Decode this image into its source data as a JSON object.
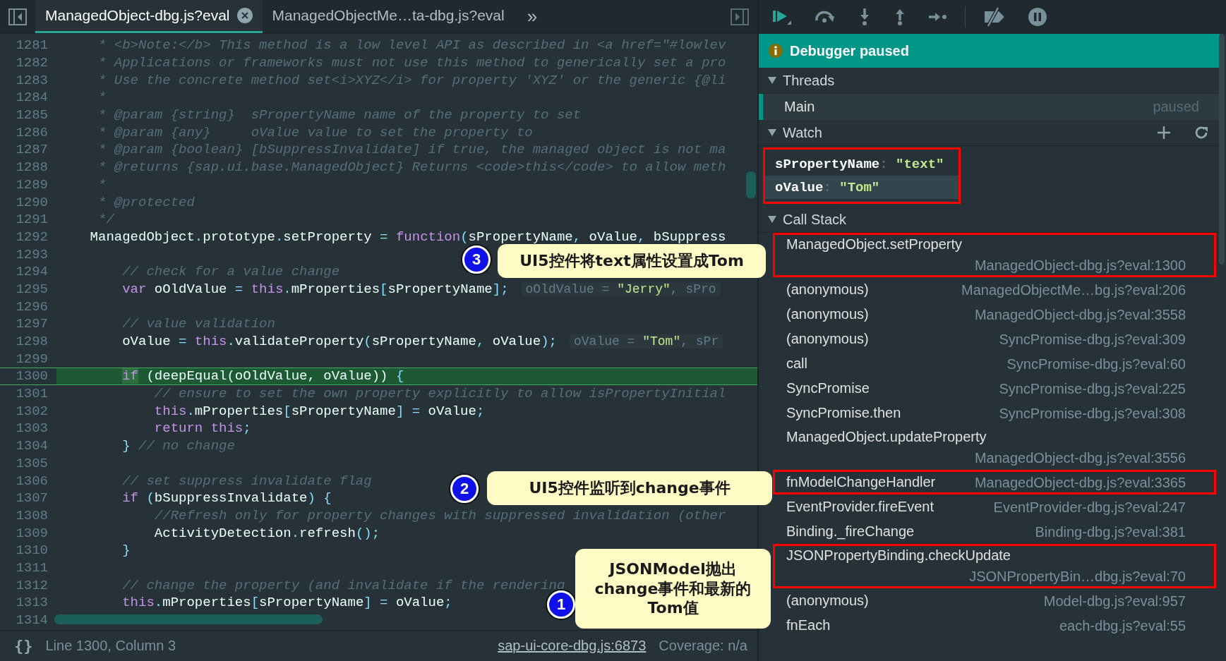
{
  "tabs": [
    {
      "label": "ManagedObject-dbg.js?eval",
      "selected": true,
      "closable": true
    },
    {
      "label": "ManagedObjectMe…ta-dbg.js?eval",
      "selected": false,
      "closable": false
    }
  ],
  "more_tabs": "»",
  "code": {
    "lines": [
      {
        "number": "1281",
        "current": false,
        "tokens": [
          {
            "kind": "comment",
            "text": "     * <b>Note:</b> This method is a low level API as described in <a href=\"#lowlev"
          }
        ]
      },
      {
        "number": "1282",
        "current": false,
        "tokens": [
          {
            "kind": "comment",
            "text": "     * Applications or frameworks must not use this method to generically set a pro"
          }
        ]
      },
      {
        "number": "1283",
        "current": false,
        "tokens": [
          {
            "kind": "comment",
            "text": "     * Use the concrete method set<i>XYZ</i> for property 'XYZ' or the generic {@li"
          }
        ]
      },
      {
        "number": "1284",
        "current": false,
        "tokens": [
          {
            "kind": "comment",
            "text": "     *"
          }
        ]
      },
      {
        "number": "1285",
        "current": false,
        "tokens": [
          {
            "kind": "comment",
            "text": "     * @param {string}  sPropertyName name of the property to set"
          }
        ]
      },
      {
        "number": "1286",
        "current": false,
        "tokens": [
          {
            "kind": "comment",
            "text": "     * @param {any}     oValue value to set the property to"
          }
        ]
      },
      {
        "number": "1287",
        "current": false,
        "tokens": [
          {
            "kind": "comment",
            "text": "     * @param {boolean} [bSuppressInvalidate] if true, the managed object is not ma"
          }
        ]
      },
      {
        "number": "1288",
        "current": false,
        "tokens": [
          {
            "kind": "comment",
            "text": "     * @returns {sap.ui.base.ManagedObject} Returns <code>this</code> to allow meth"
          }
        ]
      },
      {
        "number": "1289",
        "current": false,
        "tokens": [
          {
            "kind": "comment",
            "text": "     *"
          }
        ]
      },
      {
        "number": "1290",
        "current": false,
        "tokens": [
          {
            "kind": "comment",
            "text": "     * @protected"
          }
        ]
      },
      {
        "number": "1291",
        "current": false,
        "tokens": [
          {
            "kind": "comment",
            "text": "     */"
          }
        ]
      },
      {
        "number": "1292",
        "current": false,
        "tokens": [
          {
            "kind": "plain",
            "text": "    ManagedObject"
          },
          {
            "kind": "punct",
            "text": "."
          },
          {
            "kind": "plain",
            "text": "prototype"
          },
          {
            "kind": "punct",
            "text": "."
          },
          {
            "kind": "plain",
            "text": "setProperty "
          },
          {
            "kind": "punct",
            "text": "= "
          },
          {
            "kind": "keyword",
            "text": "function"
          },
          {
            "kind": "punct",
            "text": "("
          },
          {
            "kind": "plain",
            "text": "sPropertyName"
          },
          {
            "kind": "punct",
            "text": ", "
          },
          {
            "kind": "plain",
            "text": "oValue"
          },
          {
            "kind": "punct",
            "text": ", "
          },
          {
            "kind": "plain",
            "text": "bSuppress"
          }
        ]
      },
      {
        "number": "1293",
        "current": false
      },
      {
        "number": "1294",
        "current": false,
        "tokens": [
          {
            "kind": "comment",
            "text": "        // check for a value change"
          }
        ]
      },
      {
        "number": "1295",
        "current": false,
        "tokens": [
          {
            "kind": "keyword",
            "text": "        var "
          },
          {
            "kind": "plain",
            "text": "oOldValue "
          },
          {
            "kind": "punct",
            "text": "= "
          },
          {
            "kind": "keyword",
            "text": "this"
          },
          {
            "kind": "punct",
            "text": "."
          },
          {
            "kind": "plain",
            "text": "mProperties"
          },
          {
            "kind": "punct",
            "text": "["
          },
          {
            "kind": "plain",
            "text": "sPropertyName"
          },
          {
            "kind": "punct",
            "text": "];"
          }
        ],
        "inline_value": [
          {
            "kind": "plain",
            "text": "oOldValue = "
          },
          {
            "kind": "string",
            "text": "\"Jerry\""
          },
          {
            "kind": "plain",
            "text": ", sPro"
          }
        ]
      },
      {
        "number": "1296",
        "current": false
      },
      {
        "number": "1297",
        "current": false,
        "tokens": [
          {
            "kind": "comment",
            "text": "        // value validation"
          }
        ]
      },
      {
        "number": "1298",
        "current": false,
        "tokens": [
          {
            "kind": "plain",
            "text": "        oValue "
          },
          {
            "kind": "punct",
            "text": "= "
          },
          {
            "kind": "keyword",
            "text": "this"
          },
          {
            "kind": "punct",
            "text": "."
          },
          {
            "kind": "plain",
            "text": "validateProperty"
          },
          {
            "kind": "punct",
            "text": "("
          },
          {
            "kind": "plain",
            "text": "sPropertyName"
          },
          {
            "kind": "punct",
            "text": ", "
          },
          {
            "kind": "plain",
            "text": "oValue"
          },
          {
            "kind": "punct",
            "text": ");"
          }
        ],
        "inline_value": [
          {
            "kind": "plain",
            "text": "oValue = "
          },
          {
            "kind": "string",
            "text": "\"Tom\""
          },
          {
            "kind": "plain",
            "text": ", sPr"
          }
        ]
      },
      {
        "number": "1299",
        "current": false
      },
      {
        "number": "1300",
        "current": true,
        "tokens": [
          {
            "kind": "keyword",
            "text": "        if"
          },
          {
            "kind": "plain",
            "text": " (deepEqual(oOldValue, oValue)) "
          },
          {
            "kind": "punct",
            "text": "{"
          }
        ]
      },
      {
        "number": "1301",
        "current": false,
        "tokens": [
          {
            "kind": "comment",
            "text": "            // ensure to set the own property explicitly to allow isPropertyInitial"
          }
        ]
      },
      {
        "number": "1302",
        "current": false,
        "tokens": [
          {
            "kind": "keyword",
            "text": "            this"
          },
          {
            "kind": "punct",
            "text": "."
          },
          {
            "kind": "plain",
            "text": "mProperties"
          },
          {
            "kind": "punct",
            "text": "["
          },
          {
            "kind": "plain",
            "text": "sPropertyName"
          },
          {
            "kind": "punct",
            "text": "] = "
          },
          {
            "kind": "plain",
            "text": "oValue"
          },
          {
            "kind": "punct",
            "text": ";"
          }
        ]
      },
      {
        "number": "1303",
        "current": false,
        "tokens": [
          {
            "kind": "keyword",
            "text": "            return this"
          },
          {
            "kind": "punct",
            "text": ";"
          }
        ]
      },
      {
        "number": "1304",
        "current": false,
        "tokens": [
          {
            "kind": "punct",
            "text": "        }"
          },
          {
            "kind": "comment",
            "text": " // no change"
          }
        ]
      },
      {
        "number": "1305",
        "current": false
      },
      {
        "number": "1306",
        "current": false,
        "tokens": [
          {
            "kind": "comment",
            "text": "        // set suppress invalidate flag"
          }
        ]
      },
      {
        "number": "1307",
        "current": false,
        "tokens": [
          {
            "kind": "keyword",
            "text": "        if "
          },
          {
            "kind": "punct",
            "text": "("
          },
          {
            "kind": "plain",
            "text": "bSuppressInvalidate"
          },
          {
            "kind": "punct",
            "text": ") {"
          }
        ]
      },
      {
        "number": "1308",
        "current": false,
        "tokens": [
          {
            "kind": "comment",
            "text": "            //Refresh only for property changes with suppressed invalidation (other"
          }
        ]
      },
      {
        "number": "1309",
        "current": false,
        "tokens": [
          {
            "kind": "plain",
            "text": "            ActivityDetection"
          },
          {
            "kind": "punct",
            "text": "."
          },
          {
            "kind": "plain",
            "text": "refresh"
          },
          {
            "kind": "punct",
            "text": "();"
          }
        ]
      },
      {
        "number": "1310",
        "current": false,
        "tokens": [
          {
            "kind": "punct",
            "text": "        }"
          }
        ]
      },
      {
        "number": "1311",
        "current": false
      },
      {
        "number": "1312",
        "current": false,
        "tokens": [
          {
            "kind": "comment",
            "text": "        // change the property (and invalidate if the rendering"
          }
        ]
      },
      {
        "number": "1313",
        "current": false,
        "tokens": [
          {
            "kind": "keyword",
            "text": "        this"
          },
          {
            "kind": "punct",
            "text": "."
          },
          {
            "kind": "plain",
            "text": "mProperties"
          },
          {
            "kind": "punct",
            "text": "["
          },
          {
            "kind": "plain",
            "text": "sPropertyName"
          },
          {
            "kind": "punct",
            "text": "] = "
          },
          {
            "kind": "plain",
            "text": "oValue"
          },
          {
            "kind": "punct",
            "text": ";"
          }
        ]
      },
      {
        "number": "1314",
        "current": false
      }
    ]
  },
  "callouts": [
    {
      "number": "3",
      "text": "UI5控件将text属性设置成Tom"
    },
    {
      "number": "2",
      "text": "UI5控件监听到change事件"
    },
    {
      "number": "1",
      "text": "JSONModel抛出change事件和最新的Tom值"
    }
  ],
  "status_bar": {
    "format_button": "{}",
    "position": "Line 1300, Column 3",
    "source_link": "sap-ui-core-dbg.js:6873",
    "coverage": "Coverage: n/a"
  },
  "banner": "Debugger paused",
  "threads": {
    "title": "Threads",
    "expanded": true,
    "items": [
      {
        "name": "Main",
        "status": "paused",
        "selected": true
      }
    ]
  },
  "watch": {
    "title": "Watch",
    "expanded": true,
    "highlighted": true,
    "separator": ":",
    "items": [
      {
        "name": "sPropertyName",
        "value": "\"text\"",
        "selected": false
      },
      {
        "name": "oValue",
        "value": "\"Tom\"",
        "selected": true
      }
    ]
  },
  "call_stack": {
    "title": "Call Stack",
    "expanded": true,
    "items": [
      {
        "name": "ManagedObject.setProperty",
        "location": "ManagedObject-dbg.js?eval:1300",
        "two_line": true,
        "highlighted": true
      },
      {
        "name": "(anonymous)",
        "location": "ManagedObjectMe…bg.js?eval:206",
        "two_line": false,
        "highlighted": false
      },
      {
        "name": "(anonymous)",
        "location": "ManagedObject-dbg.js?eval:3558",
        "two_line": false,
        "highlighted": false
      },
      {
        "name": "(anonymous)",
        "location": "SyncPromise-dbg.js?eval:309",
        "two_line": false,
        "highlighted": false
      },
      {
        "name": "call",
        "location": "SyncPromise-dbg.js?eval:60",
        "two_line": false,
        "highlighted": false
      },
      {
        "name": "SyncPromise",
        "location": "SyncPromise-dbg.js?eval:225",
        "two_line": false,
        "highlighted": false
      },
      {
        "name": "SyncPromise.then",
        "location": "SyncPromise-dbg.js?eval:308",
        "two_line": false,
        "highlighted": false
      },
      {
        "name": "ManagedObject.updateProperty",
        "location": "ManagedObject-dbg.js?eval:3556",
        "two_line": true,
        "highlighted": false
      },
      {
        "name": "fnModelChangeHandler",
        "location": "ManagedObject-dbg.js?eval:3365",
        "two_line": false,
        "highlighted": true
      },
      {
        "name": "EventProvider.fireEvent",
        "location": "EventProvider-dbg.js?eval:247",
        "two_line": false,
        "highlighted": false
      },
      {
        "name": "Binding._fireChange",
        "location": "Binding-dbg.js?eval:381",
        "two_line": false,
        "highlighted": false
      },
      {
        "name": "JSONPropertyBinding.checkUpdate",
        "location": "JSONPropertyBin…dbg.js?eval:70",
        "two_line": true,
        "highlighted": true
      },
      {
        "name": "(anonymous)",
        "location": "Model-dbg.js?eval:957",
        "two_line": false,
        "highlighted": false
      },
      {
        "name": "fnEach",
        "location": "each-dbg.js?eval:55",
        "two_line": false,
        "highlighted": false
      }
    ]
  }
}
